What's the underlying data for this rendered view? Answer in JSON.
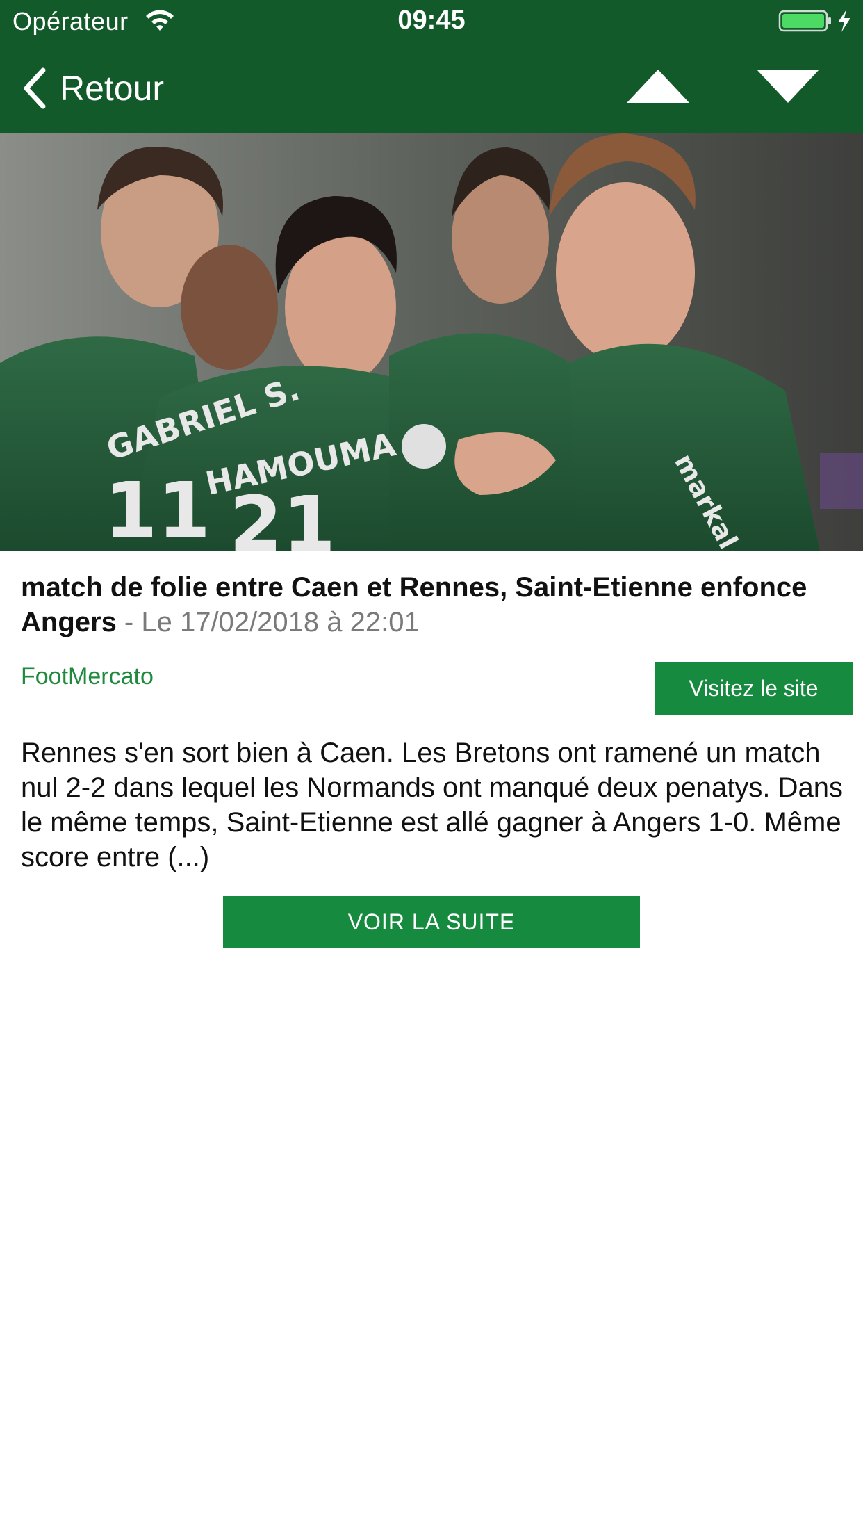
{
  "status_bar": {
    "carrier": "Opérateur",
    "time": "09:45",
    "wifi_icon": "wifi-icon",
    "battery_icon": "battery-charging-icon"
  },
  "nav_bar": {
    "back_label": "Retour",
    "back_icon": "chevron-left-icon",
    "prev_icon": "triangle-up-icon",
    "next_icon": "triangle-down-icon"
  },
  "article": {
    "headline": "match de folie entre Caen et Rennes, Saint-Etienne enfonce Angers",
    "date": " - Le 17/02/2018 à 22:01",
    "source": "FootMercato",
    "visit_button": "Visitez le site",
    "body": "Rennes s'en sort bien à Caen. Les Bretons ont ramené un match nul 2-2 dans lequel les Normands ont manqué deux penatys. Dans le même temps, Saint-Etienne est allé gagner à Angers 1-0. Même score entre (...)",
    "more_button": "VOIR LA SUITE"
  },
  "colors": {
    "header_bg": "#135a2a",
    "accent_green": "#168a3e",
    "source_green": "#1f8a3e",
    "date_gray": "#7a7a7a"
  }
}
